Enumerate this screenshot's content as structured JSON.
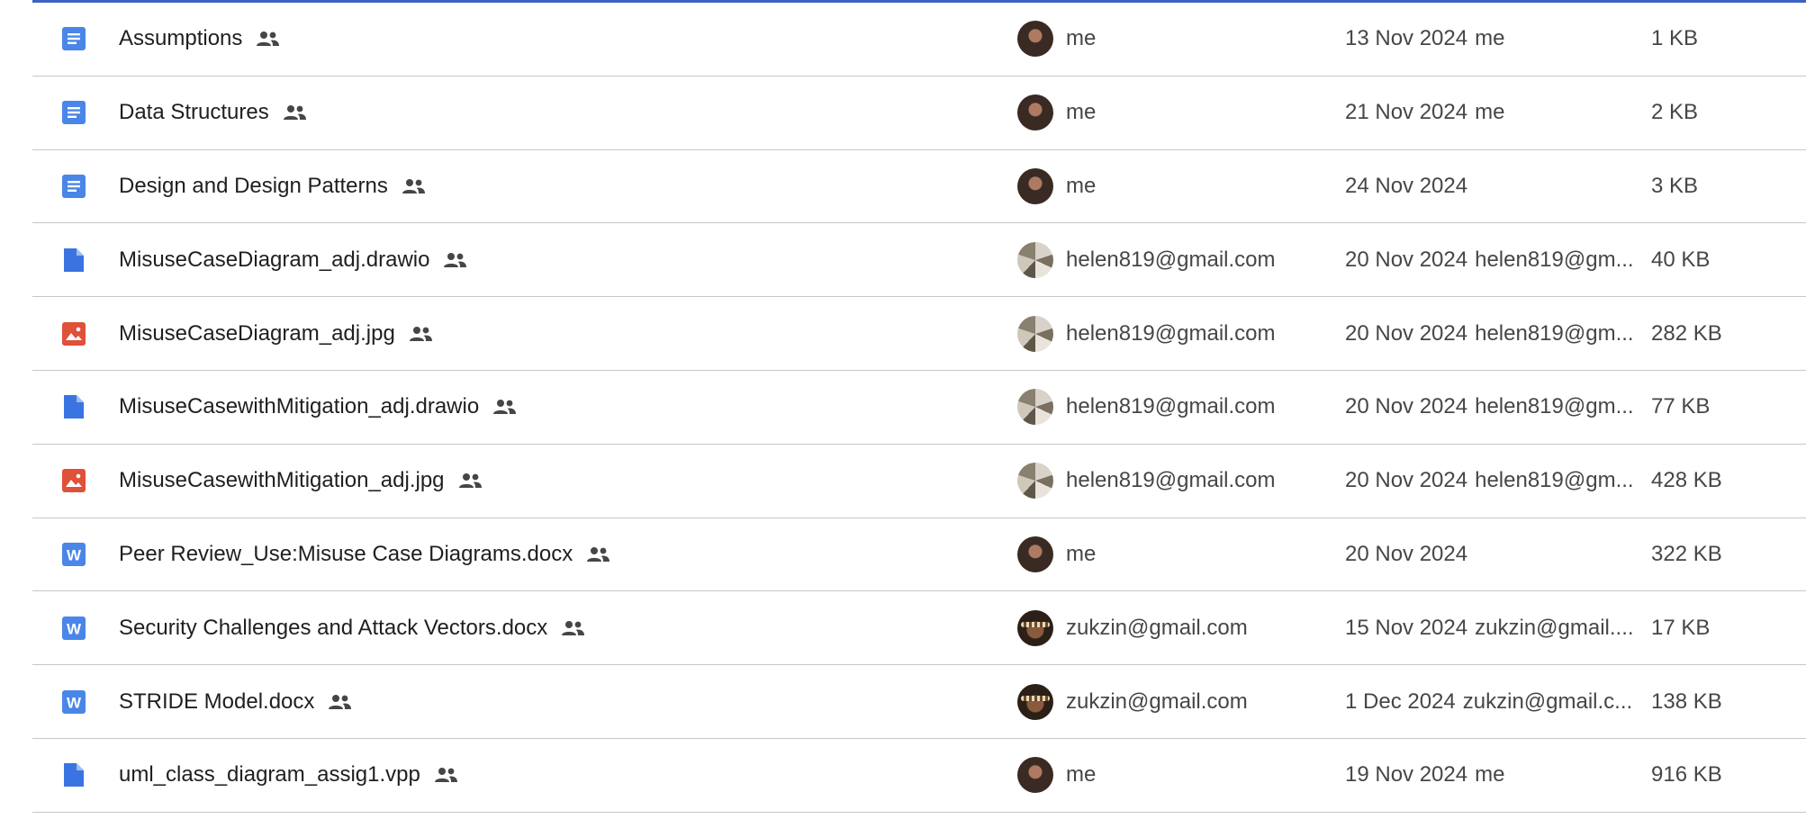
{
  "colors": {
    "doc_blue": "#4a86e8",
    "file_blue": "#3a74e0",
    "image_red": "#e0513a",
    "word_blue": "#4a86e8",
    "selection_border": "#3c62c4"
  },
  "files": [
    {
      "name": "Assumptions",
      "icon": "google-doc-icon",
      "shared": true,
      "owner": "me",
      "avatar": "me",
      "modified_date": "13 Nov 2024",
      "modified_by": "me",
      "size": "1 KB"
    },
    {
      "name": "Data Structures",
      "icon": "google-doc-icon",
      "shared": true,
      "owner": "me",
      "avatar": "me",
      "modified_date": "21 Nov 2024",
      "modified_by": "me",
      "size": "2 KB"
    },
    {
      "name": "Design and Design Patterns",
      "icon": "google-doc-icon",
      "shared": true,
      "owner": "me",
      "avatar": "me",
      "modified_date": "24 Nov 2024",
      "modified_by": "",
      "size": "3 KB"
    },
    {
      "name": "MisuseCaseDiagram_adj.drawio",
      "icon": "generic-file-icon",
      "shared": true,
      "owner": "helen819@gmail.com",
      "avatar": "helen",
      "modified_date": "20 Nov 2024",
      "modified_by": "helen819@gm...",
      "size": "40 KB"
    },
    {
      "name": "MisuseCaseDiagram_adj.jpg",
      "icon": "image-file-icon",
      "shared": true,
      "owner": "helen819@gmail.com",
      "avatar": "helen",
      "modified_date": "20 Nov 2024",
      "modified_by": "helen819@gm...",
      "size": "282 KB"
    },
    {
      "name": "MisuseCasewithMitigation_adj.drawio",
      "icon": "generic-file-icon",
      "shared": true,
      "owner": "helen819@gmail.com",
      "avatar": "helen",
      "modified_date": "20 Nov 2024",
      "modified_by": "helen819@gm...",
      "size": "77 KB"
    },
    {
      "name": "MisuseCasewithMitigation_adj.jpg",
      "icon": "image-file-icon",
      "shared": true,
      "owner": "helen819@gmail.com",
      "avatar": "helen",
      "modified_date": "20 Nov 2024",
      "modified_by": "helen819@gm...",
      "size": "428 KB"
    },
    {
      "name": "Peer Review_Use:Misuse Case Diagrams.docx",
      "icon": "word-file-icon",
      "shared": true,
      "owner": "me",
      "avatar": "me",
      "modified_date": "20 Nov 2024",
      "modified_by": "",
      "size": "322 KB"
    },
    {
      "name": "Security Challenges and Attack Vectors.docx",
      "icon": "word-file-icon",
      "shared": true,
      "owner": "zukzin@gmail.com",
      "avatar": "zuk",
      "modified_date": "15 Nov 2024",
      "modified_by": "zukzin@gmail....",
      "size": "17 KB"
    },
    {
      "name": "STRIDE Model.docx",
      "icon": "word-file-icon",
      "shared": true,
      "owner": "zukzin@gmail.com",
      "avatar": "zuk",
      "modified_date": "1 Dec 2024",
      "modified_by": "zukzin@gmail.c...",
      "size": "138 KB"
    },
    {
      "name": "uml_class_diagram_assig1.vpp",
      "icon": "generic-file-icon",
      "shared": true,
      "owner": "me",
      "avatar": "me",
      "modified_date": "19 Nov 2024",
      "modified_by": "me",
      "size": "916 KB"
    }
  ]
}
